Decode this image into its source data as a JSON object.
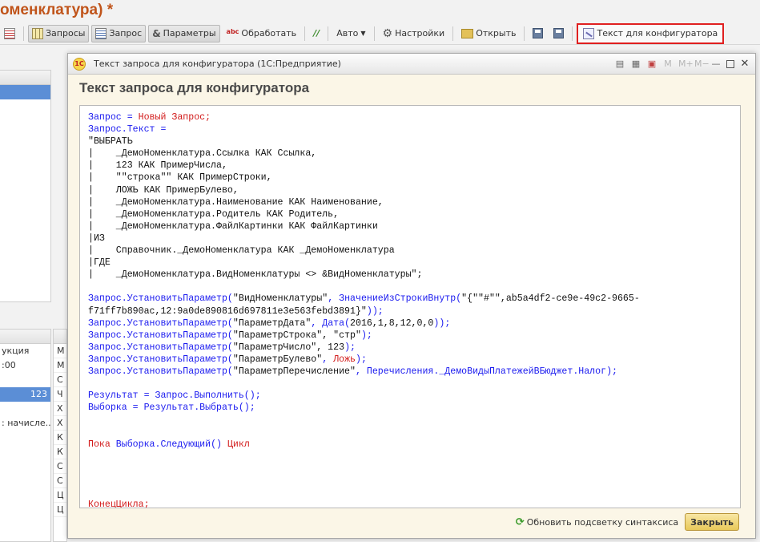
{
  "main_window": {
    "title": "оменклатура) *"
  },
  "toolbar": {
    "queries_label": "Запросы",
    "query_label": "Запрос",
    "params_label": "Параметры",
    "process_label": "Обработать",
    "auto_label": "Авто",
    "settings_label": "Настройки",
    "open_label": "Открыть",
    "configurator_text_label": "Текст для конфигуратора"
  },
  "left_panel_bottom": {
    "rows": [
      "укция",
      ":00",
      "",
      "123",
      "",
      ": начисле..."
    ]
  },
  "right_column": {
    "cells": [
      "М",
      "М",
      "С",
      "Ч",
      "Х",
      "Х",
      "К",
      "К",
      "С",
      "С",
      "Ц",
      "Ц"
    ]
  },
  "dialog": {
    "window_title": "Текст запроса для конфигуратора  (1С:Предприятие)",
    "logo_text": "1С",
    "heading": "Текст запроса для конфигуратора",
    "title_icons": [
      "M",
      "M+",
      "M−"
    ],
    "refresh_label": "Обновить подсветку синтаксиса",
    "close_label": "Закрыть"
  },
  "code_lines": [
    {
      "spans": [
        {
          "t": "Запрос = ",
          "c": "blue"
        },
        {
          "t": "Новый Запрос;",
          "c": "red"
        }
      ]
    },
    {
      "spans": [
        {
          "t": "Запрос.Текст =",
          "c": "blue"
        }
      ]
    },
    {
      "spans": [
        {
          "t": "\"ВЫБРАТЬ",
          "c": "black"
        }
      ]
    },
    {
      "spans": [
        {
          "t": "|    _ДемоНоменклатура.Ссылка КАК Ссылка,",
          "c": "black"
        }
      ]
    },
    {
      "spans": [
        {
          "t": "|    123 КАК ПримерЧисла,",
          "c": "black"
        }
      ]
    },
    {
      "spans": [
        {
          "t": "|    \"\"строка\"\" КАК ПримерСтроки,",
          "c": "black"
        }
      ]
    },
    {
      "spans": [
        {
          "t": "|    ЛОЖЬ КАК ПримерБулево,",
          "c": "black"
        }
      ]
    },
    {
      "spans": [
        {
          "t": "|    _ДемоНоменклатура.Наименование КАК Наименование,",
          "c": "black"
        }
      ]
    },
    {
      "spans": [
        {
          "t": "|    _ДемоНоменклатура.Родитель КАК Родитель,",
          "c": "black"
        }
      ]
    },
    {
      "spans": [
        {
          "t": "|    _ДемоНоменклатура.ФайлКартинки КАК ФайлКартинки",
          "c": "black"
        }
      ]
    },
    {
      "spans": [
        {
          "t": "|ИЗ",
          "c": "black"
        }
      ]
    },
    {
      "spans": [
        {
          "t": "|    Справочник._ДемоНоменклатура КАК _ДемоНоменклатура",
          "c": "black"
        }
      ]
    },
    {
      "spans": [
        {
          "t": "|ГДЕ",
          "c": "black"
        }
      ]
    },
    {
      "spans": [
        {
          "t": "|    _ДемоНоменклатура.ВидНоменклатуры <> &ВидНоменклатуры\";",
          "c": "black"
        }
      ]
    },
    {
      "spans": [
        {
          "t": "",
          "c": "black"
        }
      ]
    },
    {
      "spans": [
        {
          "t": "Запрос.УстановитьПараметр(",
          "c": "blue"
        },
        {
          "t": "\"ВидНоменклатуры\"",
          "c": "black"
        },
        {
          "t": ", ",
          "c": "blue"
        },
        {
          "t": "ЗначениеИзСтрокиВнутр(",
          "c": "blue"
        },
        {
          "t": "\"{\"\"#\"\",ab5a4df2-ce9e-49c2-9665-",
          "c": "black"
        }
      ]
    },
    {
      "spans": [
        {
          "t": "f71ff7b890ac,12:9a0de890816d697811e3e563febd3891}\"",
          "c": "black"
        },
        {
          "t": "));",
          "c": "blue"
        }
      ]
    },
    {
      "spans": [
        {
          "t": "Запрос.УстановитьПараметр(",
          "c": "blue"
        },
        {
          "t": "\"ПараметрДата\"",
          "c": "black"
        },
        {
          "t": ", ",
          "c": "blue"
        },
        {
          "t": "Дата(",
          "c": "blue"
        },
        {
          "t": "2016,1,8,12,0,0",
          "c": "black"
        },
        {
          "t": "));",
          "c": "blue"
        }
      ]
    },
    {
      "spans": [
        {
          "t": "Запрос.УстановитьПараметр(",
          "c": "blue"
        },
        {
          "t": "\"ПараметрСтрока\", \"стр\"",
          "c": "black"
        },
        {
          "t": ");",
          "c": "blue"
        }
      ]
    },
    {
      "spans": [
        {
          "t": "Запрос.УстановитьПараметр(",
          "c": "blue"
        },
        {
          "t": "\"ПараметрЧисло\", 123",
          "c": "black"
        },
        {
          "t": ");",
          "c": "blue"
        }
      ]
    },
    {
      "spans": [
        {
          "t": "Запрос.УстановитьПараметр(",
          "c": "blue"
        },
        {
          "t": "\"ПараметрБулево\"",
          "c": "black"
        },
        {
          "t": ", ",
          "c": "blue"
        },
        {
          "t": "Ложь",
          "c": "red"
        },
        {
          "t": ");",
          "c": "blue"
        }
      ]
    },
    {
      "spans": [
        {
          "t": "Запрос.УстановитьПараметр(",
          "c": "blue"
        },
        {
          "t": "\"ПараметрПеречисление\"",
          "c": "black"
        },
        {
          "t": ", ",
          "c": "blue"
        },
        {
          "t": "Перечисления._ДемоВидыПлатежейВБюджет.Налог",
          "c": "blue"
        },
        {
          "t": ");",
          "c": "blue"
        }
      ]
    },
    {
      "spans": [
        {
          "t": "",
          "c": "black"
        }
      ]
    },
    {
      "spans": [
        {
          "t": "Результат = Запрос.Выполнить();",
          "c": "blue"
        }
      ]
    },
    {
      "spans": [
        {
          "t": "Выборка = Результат.Выбрать();",
          "c": "blue"
        }
      ]
    },
    {
      "spans": [
        {
          "t": "",
          "c": "black"
        }
      ]
    },
    {
      "spans": [
        {
          "t": "",
          "c": "black"
        }
      ]
    },
    {
      "spans": [
        {
          "t": "Пока ",
          "c": "red"
        },
        {
          "t": "Выборка.Следующий() ",
          "c": "blue"
        },
        {
          "t": "Цикл",
          "c": "red"
        }
      ]
    },
    {
      "spans": [
        {
          "t": "",
          "c": "black"
        }
      ]
    },
    {
      "spans": [
        {
          "t": "",
          "c": "black"
        }
      ]
    },
    {
      "spans": [
        {
          "t": "",
          "c": "black"
        }
      ]
    },
    {
      "spans": [
        {
          "t": "",
          "c": "black"
        }
      ]
    },
    {
      "spans": [
        {
          "t": "КонецЦикла;",
          "c": "red"
        }
      ]
    }
  ]
}
